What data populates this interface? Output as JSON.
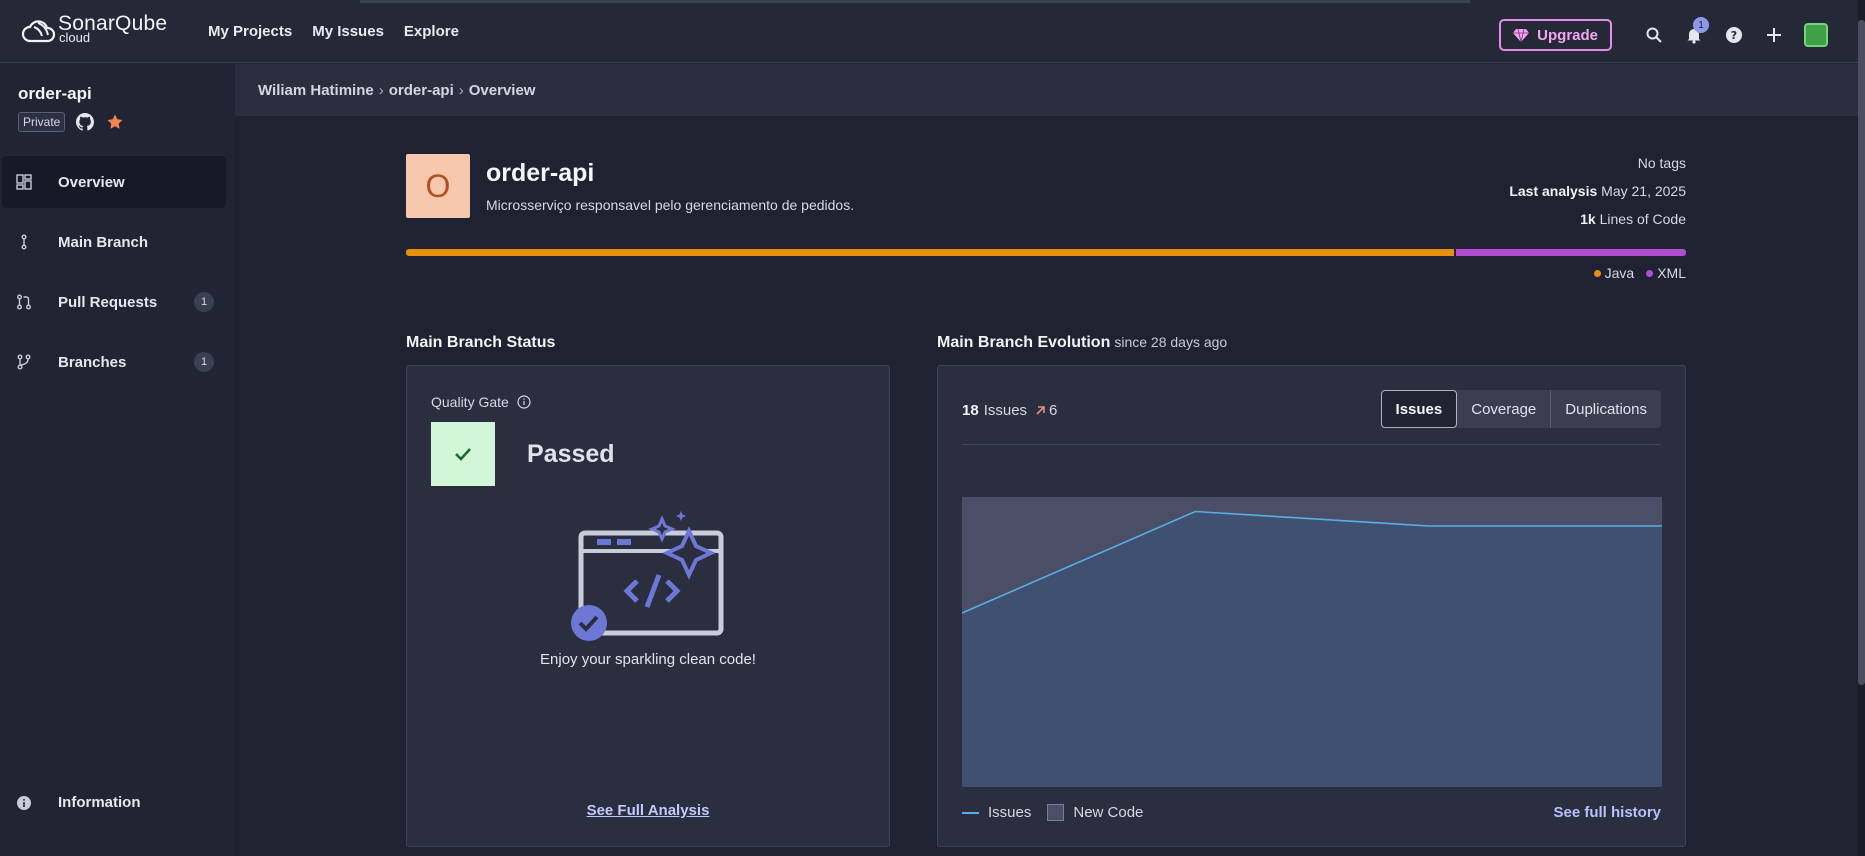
{
  "brand": {
    "name": "SonarQube",
    "sub": "cloud"
  },
  "nav": {
    "links": [
      "My Projects",
      "My Issues",
      "Explore"
    ]
  },
  "topbar": {
    "upgrade_label": "Upgrade",
    "notification_count": "1"
  },
  "sidebar": {
    "project_name": "order-api",
    "visibility": "Private",
    "items": [
      {
        "label": "Overview",
        "active": true
      },
      {
        "label": "Main Branch"
      },
      {
        "label": "Pull Requests",
        "count": "1"
      },
      {
        "label": "Branches",
        "count": "1"
      }
    ],
    "info_label": "Information"
  },
  "breadcrumb": [
    "Wiliam Hatimine",
    "order-api",
    "Overview"
  ],
  "project": {
    "initial": "O",
    "name": "order-api",
    "description": "Microsserviço responsavel pelo gerenciamento de pedidos.",
    "tags": "No tags",
    "last_analysis_label": "Last analysis",
    "last_analysis_date": "May 21, 2025",
    "loc_value": "1k",
    "loc_label": "Lines of Code",
    "languages": [
      {
        "name": "Java",
        "color": "#e8900d",
        "fraction": 0.82
      },
      {
        "name": "XML",
        "color": "#b14ed3",
        "fraction": 0.18
      }
    ]
  },
  "status": {
    "title": "Main Branch Status",
    "quality_gate_label": "Quality Gate",
    "result": "Passed",
    "message": "Enjoy your sparkling clean code!",
    "see_full": "See Full Analysis"
  },
  "evolution": {
    "title": "Main Branch Evolution",
    "since": "since 28 days ago",
    "issues_count": "18",
    "issues_label": "Issues",
    "delta": "6",
    "tabs": [
      "Issues",
      "Coverage",
      "Duplications"
    ],
    "active_tab": "Issues",
    "legend_issues": "Issues",
    "legend_new_code": "New Code",
    "see_history": "See full history"
  },
  "chart_data": {
    "type": "area",
    "series": [
      {
        "name": "Issues",
        "values": [
          12,
          19,
          18,
          18
        ]
      }
    ],
    "ylim": [
      0,
      20
    ],
    "grid": false,
    "colors": {
      "line": "#5aaee6",
      "area": "#3f5070",
      "new_code": "#4a4e66"
    }
  }
}
